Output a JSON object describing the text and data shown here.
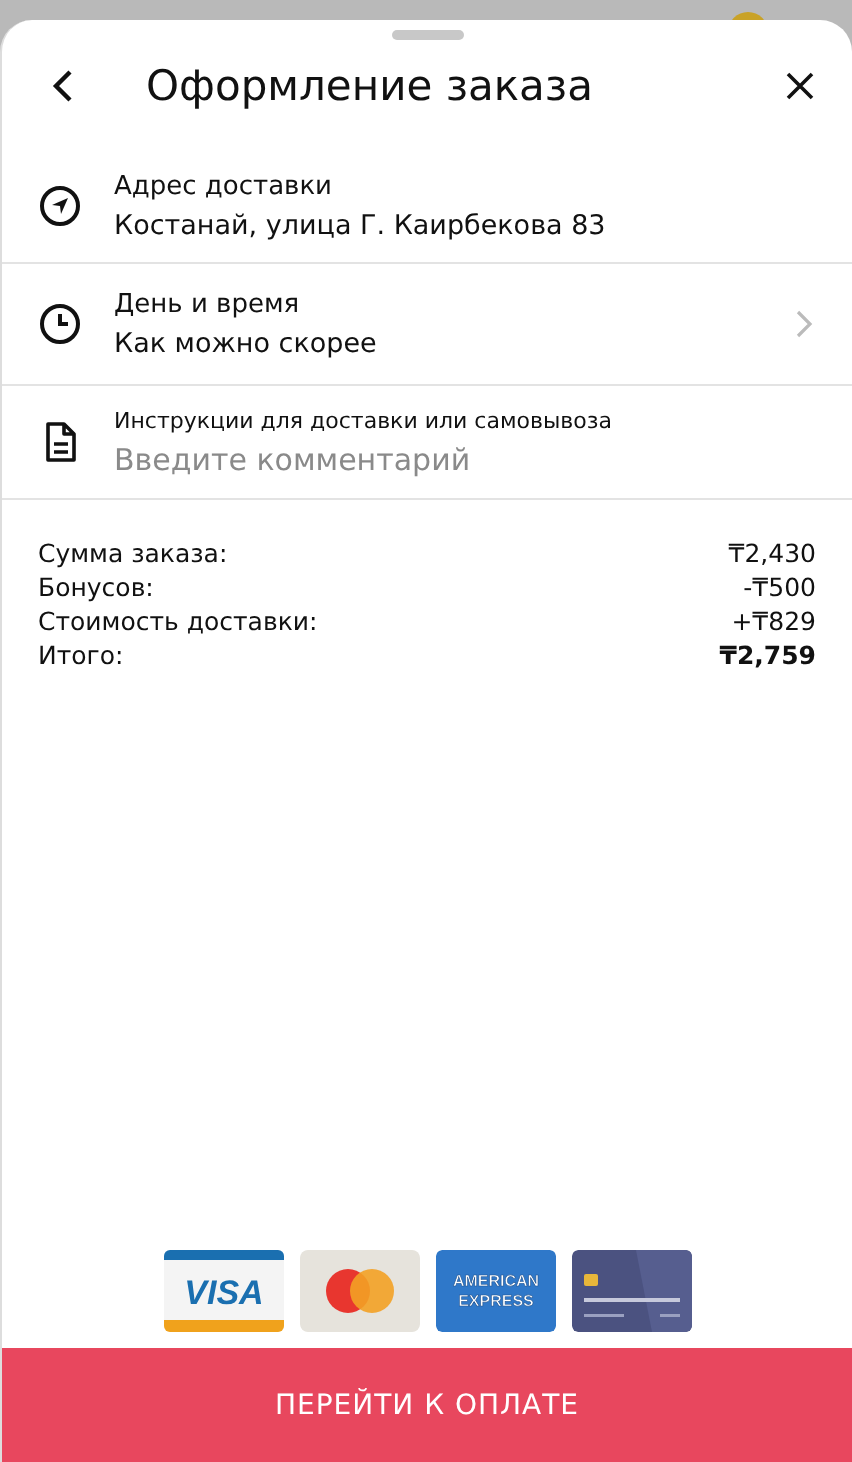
{
  "header": {
    "title": "Оформление заказа"
  },
  "rows": [
    {
      "kind": "address",
      "label": "Адрес доставки",
      "value": "Костанай, улица Г. Каирбекова 83"
    },
    {
      "kind": "schedule",
      "label": "День и время",
      "value": "Как можно скорее"
    },
    {
      "kind": "comment",
      "label": "Инструкции для доставки или самовывоза",
      "placeholder": "Введите комментарий"
    }
  ],
  "summary": [
    {
      "kind": "line",
      "label": "Сумма заказа:",
      "value": "₸2,430"
    },
    {
      "kind": "line",
      "label": "Бонусов:",
      "value": "-₸500"
    },
    {
      "kind": "line",
      "label": "Стоимость доставки:",
      "value": "+₸829"
    },
    {
      "kind": "total",
      "label": "Итого:",
      "value": "₸2,759"
    }
  ],
  "payment_cards": [
    {
      "kind": "visa",
      "text": [
        "VISA"
      ]
    },
    {
      "kind": "mastercard"
    },
    {
      "kind": "amex",
      "text": [
        "AMERICAN",
        "EXPRESS"
      ]
    },
    {
      "kind": "generic"
    }
  ],
  "pay_button": "ПЕРЕЙТИ К ОПЛАТЕ"
}
